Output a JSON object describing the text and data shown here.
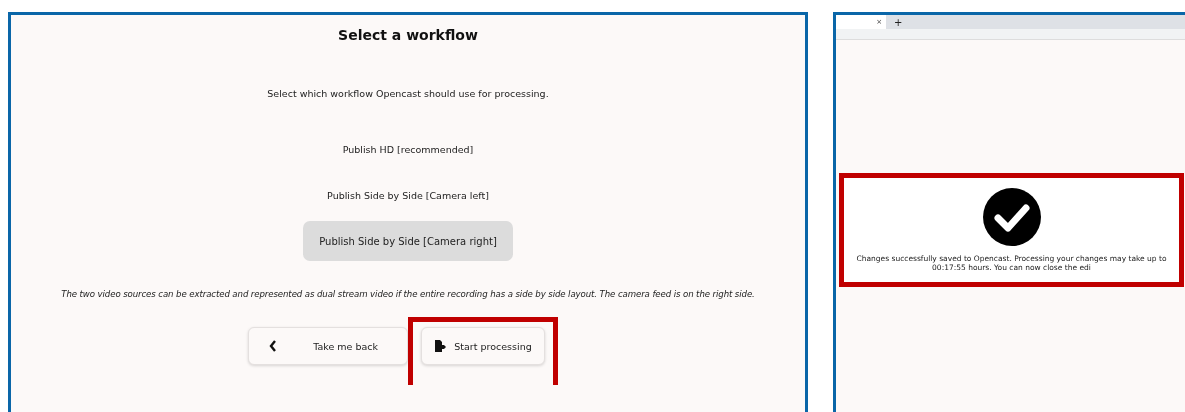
{
  "workflow_panel": {
    "title": "Select a workflow",
    "description": "Select which workflow Opencast should use for processing.",
    "options": [
      {
        "label": "Publish HD [recommended]",
        "selected": false
      },
      {
        "label": "Publish Side by Side [Camera left]",
        "selected": false
      },
      {
        "label": "Publish Side by Side [Camera right]",
        "selected": true
      }
    ],
    "option_description": "The two video sources can be extracted and represented as dual  stream video if the entire recording has a side  by  side layout. The camera feed is on the right side.",
    "buttons": [
      {
        "kind": "back",
        "label": "Take me back",
        "highlighted": false
      },
      {
        "kind": "start",
        "label": "Start processing",
        "highlighted": true
      }
    ]
  },
  "browser_panel": {
    "tabs": [
      {
        "label": "×",
        "kind": "close"
      },
      {
        "label": "+",
        "kind": "new"
      }
    ],
    "message": "Changes successfully saved to Opencast. Processing your changes may take up to 00:17:55 hours. You can now close the edi",
    "message_highlighted": true
  }
}
